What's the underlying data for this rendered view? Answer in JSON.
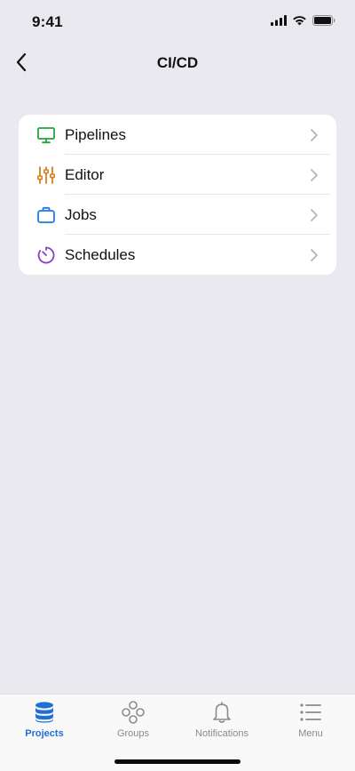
{
  "status_bar": {
    "time": "9:41"
  },
  "nav": {
    "title": "CI/CD",
    "back_icon": "chevron-left-icon"
  },
  "list": {
    "items": [
      {
        "label": "Pipelines",
        "icon": "monitor-icon",
        "color": "#22a33a"
      },
      {
        "label": "Editor",
        "icon": "sliders-icon",
        "color": "#d6801f"
      },
      {
        "label": "Jobs",
        "icon": "briefcase-icon",
        "color": "#1f78e6"
      },
      {
        "label": "Schedules",
        "icon": "timer-icon",
        "color": "#8a3fc7"
      }
    ]
  },
  "tab_bar": {
    "tabs": [
      {
        "label": "Projects",
        "icon": "database-icon",
        "active": true
      },
      {
        "label": "Groups",
        "icon": "groups-icon",
        "active": false
      },
      {
        "label": "Notifications",
        "icon": "bell-icon",
        "active": false
      },
      {
        "label": "Menu",
        "icon": "list-icon",
        "active": false
      }
    ]
  },
  "colors": {
    "accent": "#1f6fd6",
    "background": "#e9e9ef",
    "tab_inactive": "#8a8a8e"
  }
}
